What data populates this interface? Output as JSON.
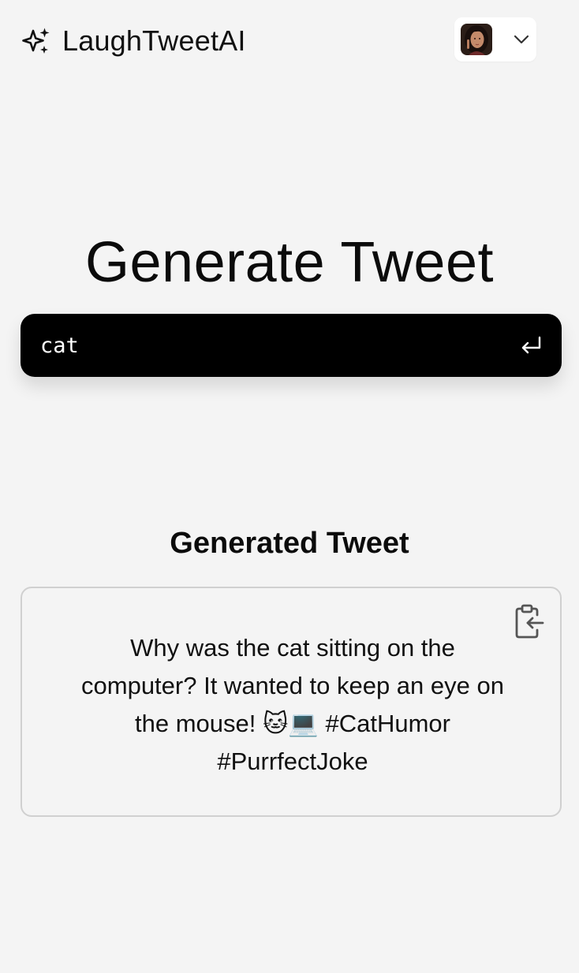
{
  "header": {
    "app_name": "LaughTweetAI",
    "logo_icon": "sparkles-icon",
    "user_avatar": "user-avatar",
    "menu_icon": "chevron-down-icon"
  },
  "main": {
    "title": "Generate Tweet",
    "search": {
      "value": "cat",
      "submit_icon": "enter-icon"
    },
    "result": {
      "title": "Generated Tweet",
      "tweet_text": "Why was the cat sitting on the computer? It wanted to keep an eye on the mouse! 🐱💻 #CatHumor #PurrfectJoke",
      "copy_icon": "clipboard-copy-icon"
    }
  },
  "colors": {
    "background": "#f4f4f4",
    "search_bg": "#000000",
    "card_border": "#d0d0d0",
    "text": "#0a0a0a"
  }
}
